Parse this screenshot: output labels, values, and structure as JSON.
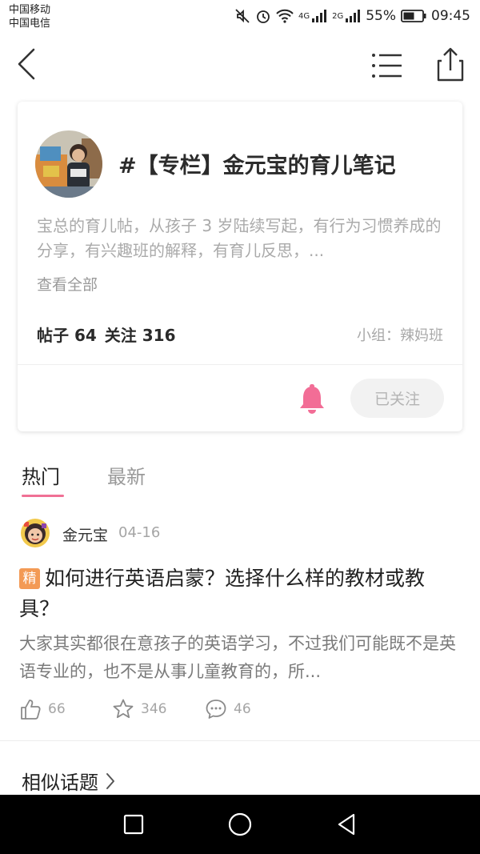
{
  "status_bar": {
    "carrier_1": "中国移动",
    "carrier_2": "中国电信",
    "network_1": "4G",
    "network_2": "2G",
    "battery": "55%",
    "time": "09:45",
    "icons": [
      "mute-icon",
      "alarm-icon",
      "wifi-icon",
      "signal-icon",
      "battery-icon"
    ]
  },
  "nav": {
    "icons": [
      "back-arrow-icon",
      "list-icon",
      "share-icon"
    ]
  },
  "topic": {
    "title": "#【专栏】金元宝的育儿笔记",
    "description": "宝总的育儿帖，从孩子 3 岁陆续写起，有行为习惯养成的分享，有兴趣班的解释，有育儿反思，...",
    "view_all": "查看全部",
    "posts_label": "帖子 64",
    "follows_label": "关注 316",
    "group": "小组：辣妈班",
    "follow_button": "已关注",
    "bell_color": "#f26d96"
  },
  "tabs": {
    "hot": "热门",
    "new": "最新",
    "accent": "#f07095"
  },
  "post": {
    "author": "金元宝",
    "date": "04-16",
    "badge": "精",
    "title": "如何进行英语启蒙？选择什么样的教材或教具？",
    "excerpt": "大家其实都很在意孩子的英语学习，不过我们可能既不是英语专业的，也不是从事儿童教育的，所...",
    "likes": "66",
    "favorites": "346",
    "comments": "46"
  },
  "similar": {
    "label": "相似话题"
  }
}
